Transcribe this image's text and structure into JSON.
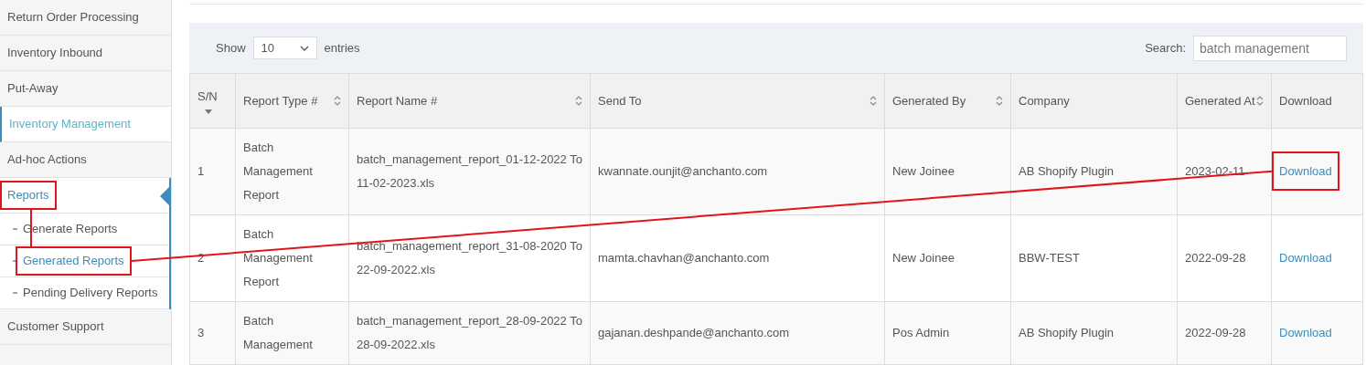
{
  "sidebar": {
    "items": [
      {
        "label": "Return Order Processing",
        "kind": "section",
        "selected": false,
        "expanded": false,
        "highlighted": false
      },
      {
        "label": "Inventory Inbound",
        "kind": "section",
        "selected": false,
        "expanded": false,
        "highlighted": false
      },
      {
        "label": "Put-Away",
        "kind": "section",
        "selected": false,
        "expanded": false,
        "highlighted": false
      },
      {
        "label": "Inventory Management",
        "kind": "section",
        "selected": true,
        "expanded": false,
        "highlighted": false
      },
      {
        "label": "Ad-hoc Actions",
        "kind": "section",
        "selected": false,
        "expanded": false,
        "highlighted": false
      },
      {
        "label": "Reports",
        "kind": "section",
        "selected": false,
        "expanded": true,
        "highlighted": true,
        "children": [
          {
            "label": "Generate Reports",
            "kind": "subitem",
            "selected": false,
            "expanded": false,
            "highlighted": false
          },
          {
            "label": "Generated Reports",
            "kind": "subitem",
            "selected": true,
            "expanded": false,
            "highlighted": true
          },
          {
            "label": "Pending Delivery Reports",
            "kind": "subitem",
            "selected": false,
            "expanded": false,
            "highlighted": false
          }
        ]
      },
      {
        "label": "Customer Support",
        "kind": "section",
        "selected": false,
        "expanded": false,
        "highlighted": false
      }
    ]
  },
  "toolbar": {
    "show_label": "Show",
    "page_size": "10",
    "entries_label": "entries",
    "search_label": "Search:",
    "search_value": "batch management"
  },
  "table": {
    "columns": [
      {
        "label": "S/N",
        "sortable": true,
        "sorted": true
      },
      {
        "label": "Report Type #",
        "sortable": true,
        "sorted": false
      },
      {
        "label": "Report Name #",
        "sortable": true,
        "sorted": false
      },
      {
        "label": "Send To",
        "sortable": true,
        "sorted": false
      },
      {
        "label": "Generated By",
        "sortable": true,
        "sorted": false
      },
      {
        "label": "Company",
        "sortable": false,
        "sorted": false
      },
      {
        "label": "Generated At",
        "sortable": true,
        "sorted": false
      },
      {
        "label": "Download",
        "sortable": false,
        "sorted": false
      }
    ],
    "rows": [
      {
        "cells": [
          "1",
          "Batch Management Report",
          "batch_management_report_01-12-2022 To 11-02-2023.xls",
          "kwannate.ounjit@anchanto.com",
          "New Joinee",
          "AB Shopify Plugin",
          "2023-02-11"
        ],
        "download": {
          "label": "Download",
          "highlighted": true
        }
      },
      {
        "cells": [
          "2",
          "Batch Management Report",
          "batch_management_report_31-08-2020 To 22-09-2022.xls",
          "mamta.chavhan@anchanto.com",
          "New Joinee",
          "BBW-TEST",
          "2022-09-28"
        ],
        "download": {
          "label": "Download",
          "highlighted": false
        }
      },
      {
        "cells": [
          "3",
          "Batch Management",
          "batch_management_report_28-09-2022 To 28-09-2022.xls",
          "gajanan.deshpande@anchanto.com",
          "Pos Admin",
          "AB Shopify Plugin",
          "2022-09-28"
        ],
        "download": {
          "label": "Download",
          "highlighted": false
        }
      }
    ]
  }
}
